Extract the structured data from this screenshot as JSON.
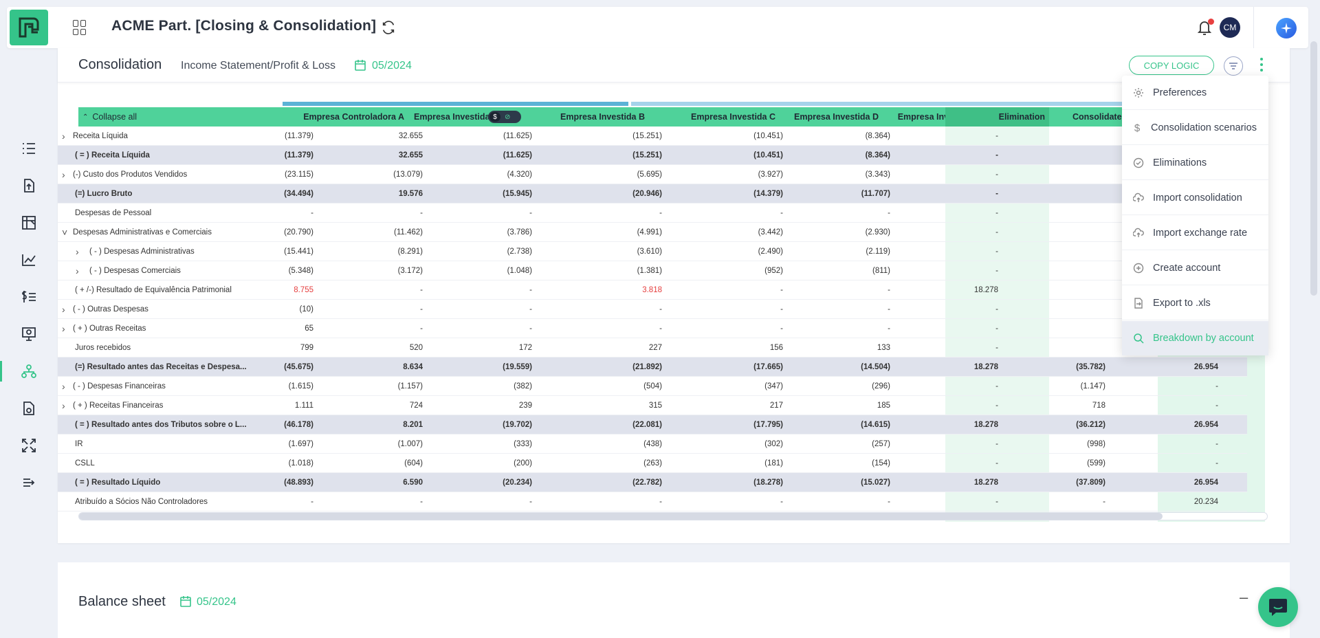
{
  "header": {
    "app_title": "ACME Part. [Closing & Consolidation]",
    "avatar_initials": "CM"
  },
  "sidebar": {
    "icons": [
      "list-icon",
      "upload-file-icon",
      "ledger-icon",
      "line-chart-icon",
      "currency-list-icon",
      "presentation-icon",
      "org-chart-icon",
      "report-icon",
      "expand-icon",
      "collapse-sidebar-icon"
    ],
    "active_icon": "org-chart-icon"
  },
  "consolidation": {
    "title": "Consolidation",
    "subtitle": "Income Statement/Profit & Loss",
    "date": "05/2024",
    "copy_logic_label": "COPY LOGIC",
    "table": {
      "collapse_label": "Collapse all",
      "columns": [
        "Empresa Controladora A",
        "Empresa Investida A",
        "Empresa Investida B",
        "Empresa Investida C",
        "Empresa Investida D",
        "Empresa Investida E",
        "Elimination",
        "Consolidate"
      ],
      "currency_toggle": "$",
      "rows": [
        {
          "label": "Receita Líquida",
          "indent": 0,
          "chevron": ">",
          "sub": false,
          "values": [
            "(11.379)",
            "32.655",
            "(11.625)",
            "(15.251)",
            "(10.451)",
            "(8.364)",
            "-",
            "",
            ""
          ]
        },
        {
          "label": "( = ) Receita Líquida",
          "indent": 0,
          "chevron": "",
          "sub": true,
          "values": [
            "(11.379)",
            "32.655",
            "(11.625)",
            "(15.251)",
            "(10.451)",
            "(8.364)",
            "-",
            "",
            ""
          ]
        },
        {
          "label": "(-) Custo dos Produtos Vendidos",
          "indent": 0,
          "chevron": ">",
          "sub": false,
          "values": [
            "(23.115)",
            "(13.079)",
            "(4.320)",
            "(5.695)",
            "(3.927)",
            "(3.343)",
            "-",
            "",
            ""
          ]
        },
        {
          "label": "(=) Lucro Bruto",
          "indent": 0,
          "chevron": "",
          "sub": true,
          "values": [
            "(34.494)",
            "19.576",
            "(15.945)",
            "(20.946)",
            "(14.379)",
            "(11.707)",
            "-",
            "",
            ""
          ]
        },
        {
          "label": "Despesas de Pessoal",
          "indent": 0,
          "chevron": "",
          "sub": false,
          "values": [
            "-",
            "-",
            "-",
            "-",
            "-",
            "-",
            "-",
            "",
            ""
          ]
        },
        {
          "label": "Despesas Administrativas e Comerciais",
          "indent": 0,
          "chevron": "v",
          "sub": false,
          "values": [
            "(20.790)",
            "(11.462)",
            "(3.786)",
            "(4.991)",
            "(3.442)",
            "(2.930)",
            "-",
            "",
            ""
          ]
        },
        {
          "label": "( - ) Despesas Administrativas",
          "indent": 1,
          "chevron": ">",
          "sub": false,
          "values": [
            "(15.441)",
            "(8.291)",
            "(2.738)",
            "(3.610)",
            "(2.490)",
            "(2.119)",
            "-",
            "",
            ""
          ]
        },
        {
          "label": "( - ) Despesas Comerciais",
          "indent": 1,
          "chevron": ">",
          "sub": false,
          "values": [
            "(5.348)",
            "(3.172)",
            "(1.048)",
            "(1.381)",
            "(952)",
            "(811)",
            "-",
            "",
            ""
          ]
        },
        {
          "label": "( + /-) Resultado de Equivalência Patrimonial",
          "indent": 0,
          "chevron": "",
          "sub": false,
          "values": [
            "8.755",
            "-",
            "-",
            "3.818",
            "-",
            "-",
            "18.278",
            "",
            ""
          ],
          "red": [
            0,
            3
          ]
        },
        {
          "label": "( - ) Outras Despesas",
          "indent": 0,
          "chevron": ">",
          "sub": false,
          "values": [
            "(10)",
            "-",
            "-",
            "-",
            "-",
            "-",
            "-",
            "",
            ""
          ]
        },
        {
          "label": "( + ) Outras Receitas",
          "indent": 0,
          "chevron": ">",
          "sub": false,
          "values": [
            "65",
            "-",
            "-",
            "-",
            "-",
            "-",
            "-",
            "",
            ""
          ]
        },
        {
          "label": "Juros recebidos",
          "indent": 0,
          "chevron": "",
          "sub": false,
          "values": [
            "799",
            "520",
            "172",
            "227",
            "156",
            "133",
            "-",
            "",
            ""
          ]
        },
        {
          "label": "(=) Resultado antes das Receitas e Despesa...",
          "indent": 0,
          "chevron": "",
          "sub": true,
          "values": [
            "(45.675)",
            "8.634",
            "(19.559)",
            "(21.892)",
            "(17.665)",
            "(14.504)",
            "18.278",
            "(35.782)",
            "26.954"
          ]
        },
        {
          "label": "( - ) Despesas Financeiras",
          "indent": 0,
          "chevron": ">",
          "sub": false,
          "values": [
            "(1.615)",
            "(1.157)",
            "(382)",
            "(504)",
            "(347)",
            "(296)",
            "-",
            "(1.147)",
            "-"
          ]
        },
        {
          "label": "( + ) Receitas Financeiras",
          "indent": 0,
          "chevron": ">",
          "sub": false,
          "values": [
            "1.111",
            "724",
            "239",
            "315",
            "217",
            "185",
            "-",
            "718",
            "-"
          ]
        },
        {
          "label": "( = ) Resultado antes dos Tributos sobre o L...",
          "indent": 0,
          "chevron": "",
          "sub": true,
          "values": [
            "(46.178)",
            "8.201",
            "(19.702)",
            "(22.081)",
            "(17.795)",
            "(14.615)",
            "18.278",
            "(36.212)",
            "26.954"
          ]
        },
        {
          "label": "IR",
          "indent": 0,
          "chevron": "",
          "sub": false,
          "values": [
            "(1.697)",
            "(1.007)",
            "(333)",
            "(438)",
            "(302)",
            "(257)",
            "-",
            "(998)",
            "-"
          ]
        },
        {
          "label": "CSLL",
          "indent": 0,
          "chevron": "",
          "sub": false,
          "values": [
            "(1.018)",
            "(604)",
            "(200)",
            "(263)",
            "(181)",
            "(154)",
            "-",
            "(599)",
            "-"
          ]
        },
        {
          "label": "( = ) Resultado Líquido",
          "indent": 0,
          "chevron": "",
          "sub": true,
          "values": [
            "(48.893)",
            "6.590",
            "(20.234)",
            "(22.782)",
            "(18.278)",
            "(15.027)",
            "18.278",
            "(37.809)",
            "26.954"
          ]
        },
        {
          "label": "Atribuído a Sócios Não Controladores",
          "indent": 0,
          "chevron": "",
          "sub": false,
          "values": [
            "-",
            "-",
            "-",
            "-",
            "-",
            "-",
            "-",
            "-",
            "20.234"
          ]
        }
      ]
    }
  },
  "menu": {
    "items": [
      {
        "label": "Preferences",
        "icon": "gear-icon"
      },
      {
        "label": "Consolidation scenarios",
        "icon": "dollar-icon"
      },
      {
        "label": "Eliminations",
        "icon": "check-circle-icon"
      },
      {
        "label": "Import consolidation",
        "icon": "cloud-upload-icon"
      },
      {
        "label": "Import exchange rate",
        "icon": "cloud-upload-icon"
      },
      {
        "label": "Create account",
        "icon": "plus-circle-icon"
      },
      {
        "label": "Export to .xls",
        "icon": "file-export-icon"
      },
      {
        "label": "Breakdown by account",
        "icon": "search-icon"
      }
    ],
    "active": "Breakdown by account"
  },
  "balance_sheet": {
    "title": "Balance sheet",
    "date": "05/2024",
    "minimize_label": "–"
  },
  "colors": {
    "accent": "#35c48a",
    "header_green": "#4fd29a",
    "subtotal_bg": "#dfe2ec",
    "negative": "#e53e3e"
  }
}
